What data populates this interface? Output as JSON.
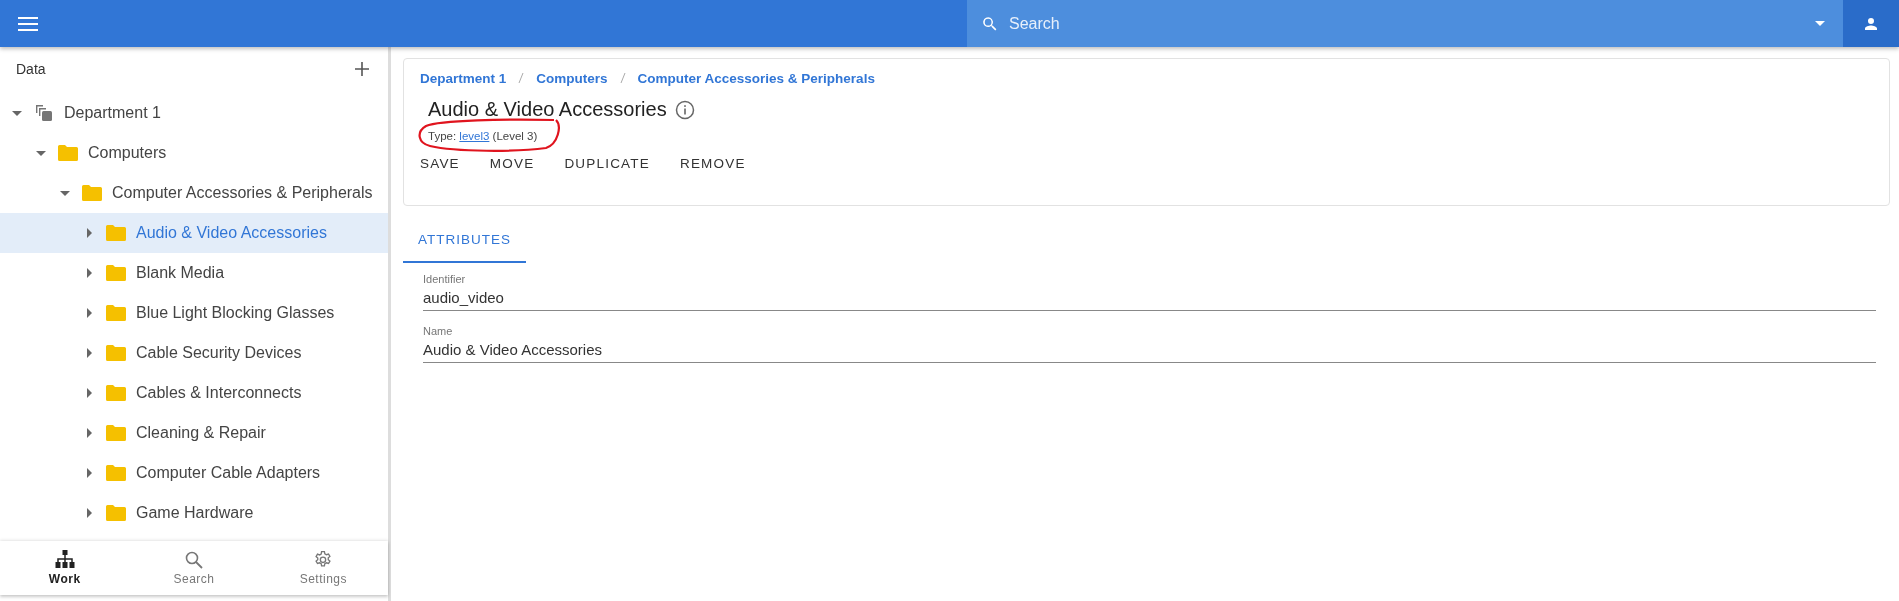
{
  "top_bar": {
    "search": {
      "placeholder": "Search"
    }
  },
  "sidebar": {
    "title": "Data",
    "tree": [
      {
        "label": "Department 1",
        "kind": "department",
        "expanded": true,
        "selected": false,
        "children": [
          {
            "label": "Computers",
            "kind": "folder",
            "expanded": true,
            "selected": false,
            "children": [
              {
                "label": "Computer Accessories & Peripherals",
                "kind": "folder",
                "expanded": true,
                "selected": false,
                "children": [
                  {
                    "label": "Audio & Video Accessories",
                    "kind": "folder",
                    "expanded": false,
                    "selected": true
                  },
                  {
                    "label": "Blank Media",
                    "kind": "folder",
                    "expanded": false,
                    "selected": false
                  },
                  {
                    "label": "Blue Light Blocking Glasses",
                    "kind": "folder",
                    "expanded": false,
                    "selected": false
                  },
                  {
                    "label": "Cable Security Devices",
                    "kind": "folder",
                    "expanded": false,
                    "selected": false
                  },
                  {
                    "label": "Cables & Interconnects",
                    "kind": "folder",
                    "expanded": false,
                    "selected": false
                  },
                  {
                    "label": "Cleaning & Repair",
                    "kind": "folder",
                    "expanded": false,
                    "selected": false
                  },
                  {
                    "label": "Computer Cable Adapters",
                    "kind": "folder",
                    "expanded": false,
                    "selected": false
                  },
                  {
                    "label": "Game Hardware",
                    "kind": "folder",
                    "expanded": false,
                    "selected": false
                  }
                ]
              }
            ]
          }
        ]
      }
    ],
    "bottom_nav": [
      {
        "label": "Work",
        "kind": "hierarchy",
        "selected": true
      },
      {
        "label": "Search",
        "kind": "search",
        "selected": false
      },
      {
        "label": "Settings",
        "kind": "settings",
        "selected": false
      }
    ]
  },
  "detail": {
    "breadcrumbs": [
      "Department 1",
      "Computers",
      "Computer Accessories & Peripherals"
    ],
    "title": "Audio & Video Accessories",
    "type": {
      "prefix": "Type:",
      "link": "level3",
      "suffix": "(Level 3)",
      "circled": true
    },
    "actions": [
      "SAVE",
      "MOVE",
      "DUPLICATE",
      "REMOVE"
    ],
    "tabs": [
      {
        "label": "ATTRIBUTES",
        "selected": true
      }
    ],
    "fields": [
      {
        "label": "Identifier",
        "value": "audio_video"
      },
      {
        "label": "Name",
        "value": "Audio & Video Accessories"
      }
    ]
  }
}
